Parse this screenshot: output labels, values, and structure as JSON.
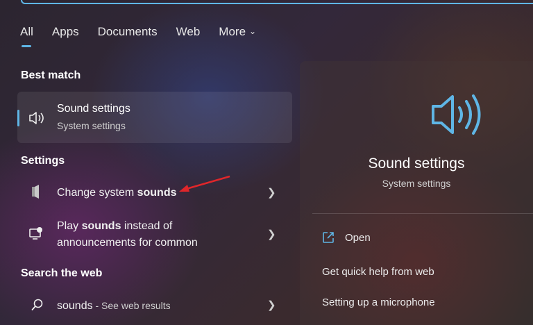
{
  "tabs": [
    "All",
    "Apps",
    "Documents",
    "Web",
    "More"
  ],
  "sections": {
    "best_match": "Best match",
    "settings": "Settings",
    "search_web": "Search the web"
  },
  "best_match": {
    "title": "Sound settings",
    "subtitle": "System settings"
  },
  "settings_items": [
    {
      "text_pre": "Change system ",
      "text_bold": "sounds",
      "text_post": ""
    },
    {
      "line1_pre": "Play ",
      "line1_bold": "sounds",
      "line1_post": " instead of",
      "line2": "announcements for common"
    }
  ],
  "web_item": {
    "query": "sounds",
    "suffix": " - See web results"
  },
  "detail": {
    "title": "Sound settings",
    "subtitle": "System settings",
    "actions": [
      "Open",
      "Get quick help from web",
      "Setting up a microphone"
    ]
  },
  "colors": {
    "accent": "#5fb6e6",
    "annotation_arrow": "#e0262a"
  }
}
